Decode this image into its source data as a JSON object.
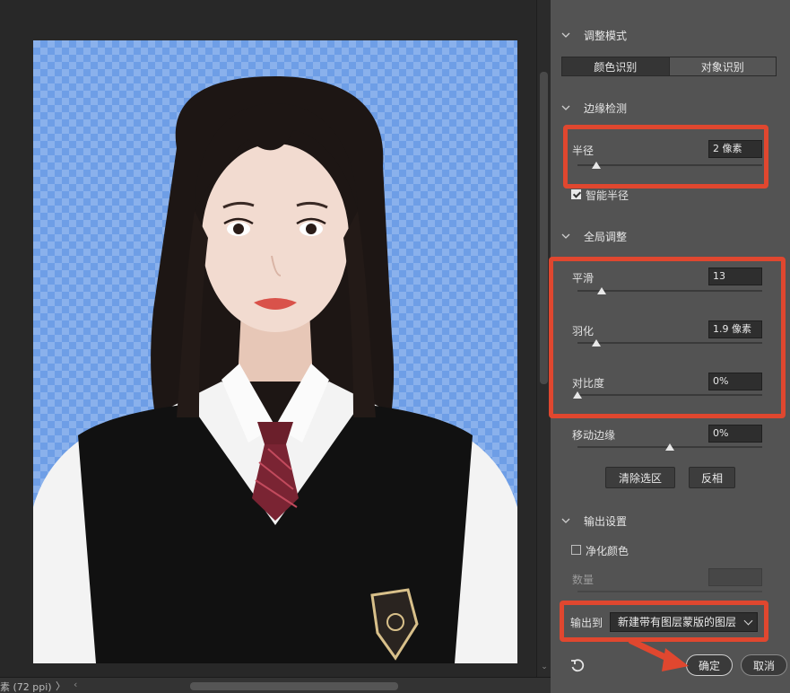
{
  "status": {
    "zoom_text": "素 (72 ppi)",
    "next_arrow": "〉",
    "prev_arrow": "‹"
  },
  "panel": {
    "mode_section": {
      "title": "调整模式",
      "tabs": [
        {
          "label": "颜色识别",
          "selected": true
        },
        {
          "label": "对象识别",
          "selected": false
        }
      ]
    },
    "edge_section": {
      "title": "边缘检测",
      "radius_label": "半径",
      "radius_value": "2 像素",
      "radius_slider": 0.1,
      "smart_radius_label": "智能半径",
      "smart_radius_checked": true
    },
    "global_section": {
      "title": "全局调整",
      "smooth_label": "平滑",
      "smooth_value": "13",
      "smooth_slider": 0.13,
      "feather_label": "羽化",
      "feather_value": "1.9 像素",
      "feather_slider": 0.1,
      "contrast_label": "对比度",
      "contrast_value": "0%",
      "contrast_slider": 0.0,
      "shift_label": "移动边缘",
      "shift_value": "0%",
      "shift_slider": 0.5,
      "clear_selection": "清除选区",
      "invert": "反相"
    },
    "output_section": {
      "title": "输出设置",
      "decontaminate_label": "净化颜色",
      "decontaminate_checked": false,
      "amount_label": "数量",
      "amount_value": "",
      "output_to_label": "输出到",
      "output_to_value": "新建带有图层蒙版的图层"
    },
    "buttons": {
      "ok": "确定",
      "cancel": "取消"
    }
  },
  "colors": {
    "panel_bg": "#535353",
    "canvas_bg": "#282828",
    "highlight_red": "#e0472f",
    "transparency_blue": "#8ab1ec"
  }
}
